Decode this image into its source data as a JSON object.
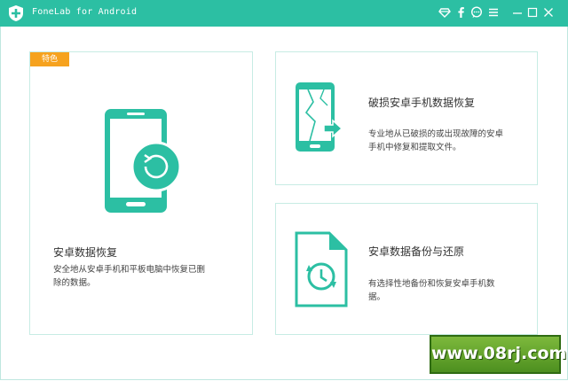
{
  "window": {
    "title": "FoneLab for Android"
  },
  "titlebar": {
    "icons": [
      "diamond-icon",
      "facebook-icon",
      "chat-icon",
      "menu-icon",
      "minimize-icon",
      "maximize-icon",
      "close-icon"
    ]
  },
  "cards": {
    "android_recovery": {
      "badge": "特色",
      "title": "安卓数据恢复",
      "desc_line1": "安全地从安卓手机和平板电脑中恢复已删",
      "desc_line2": "除的数据。"
    },
    "broken_recovery": {
      "title": "破损安卓手机数据恢复",
      "desc_line1": "专业地从已破损的或出现故障的安卓",
      "desc_line2": "手机中修复和提取文件。"
    },
    "backup_restore": {
      "title": "安卓数据备份与还原",
      "desc_line1": "有选择性地备份和恢复安卓手机数",
      "desc_line2": "据。"
    }
  },
  "watermark": {
    "text": "www.08rj.com"
  },
  "colors": {
    "accent": "#2cbfa3",
    "badge": "#f6a21e",
    "border": "#c7ece4"
  }
}
